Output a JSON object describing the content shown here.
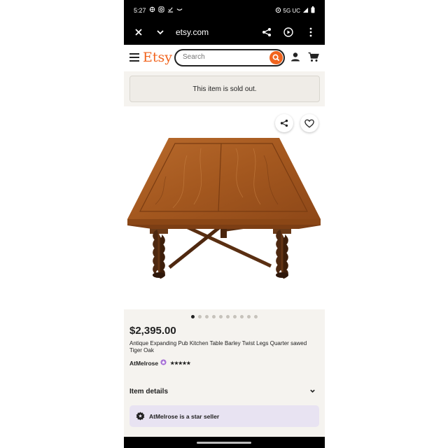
{
  "status_bar": {
    "time": "5:27",
    "network": "5G UC"
  },
  "browser": {
    "url": "etsy.com"
  },
  "etsy": {
    "logo": "Etsy",
    "search_placeholder": "Search"
  },
  "banner": {
    "text": "This item is sold out."
  },
  "carousel": {
    "dot_count": 10,
    "active_index": 0
  },
  "listing": {
    "price": "$2,395.00",
    "title": "Antique Expanding Pub Kitchen Table Barley Twist Legs Quarter sawed Tiger Oak",
    "shop_name": "AtMelrose",
    "stars": "★★★★★",
    "item_details_label": "Item details",
    "star_seller_text": "AtMelrose is a star seller"
  },
  "colors": {
    "accent": "#f1641e",
    "star_seller_bg": "#e8e3f2",
    "page_bg": "#f5f3ef",
    "star_badge": "#a56dd5"
  }
}
